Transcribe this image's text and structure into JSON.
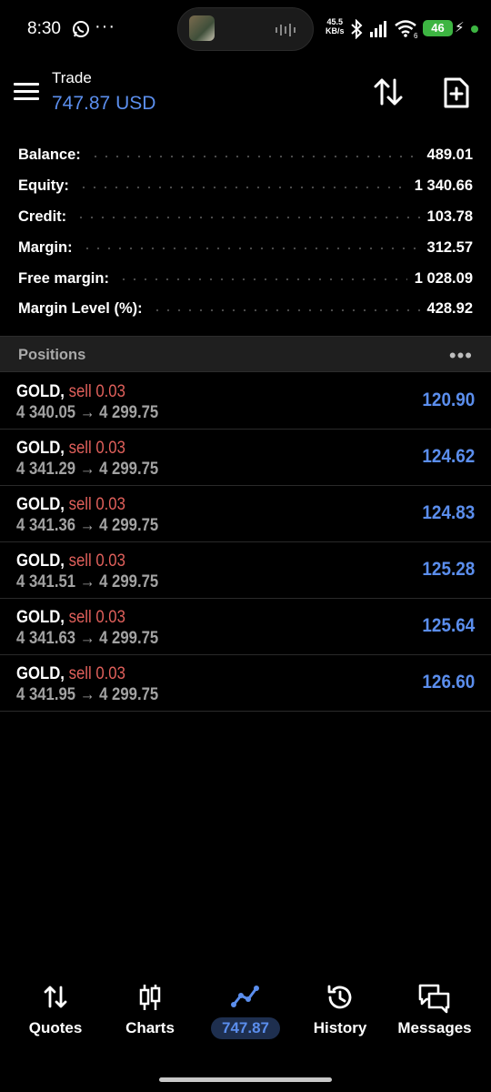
{
  "status_bar": {
    "time": "8:30",
    "more": "···",
    "net_speed_value": "45.5",
    "net_speed_unit": "KB/s",
    "battery": "46",
    "wifi_label": "6"
  },
  "header": {
    "title": "Trade",
    "subtitle": "747.87 USD"
  },
  "summary": [
    {
      "label": "Balance:",
      "value": "489.01"
    },
    {
      "label": "Equity:",
      "value": "1 340.66"
    },
    {
      "label": "Credit:",
      "value": "103.78"
    },
    {
      "label": "Margin:",
      "value": "312.57"
    },
    {
      "label": "Free margin:",
      "value": "1 028.09"
    },
    {
      "label": "Margin Level (%):",
      "value": "428.92"
    }
  ],
  "positions": {
    "title": "Positions",
    "more": "•••",
    "items": [
      {
        "symbol": "GOLD,",
        "side": "sell 0.03",
        "open": "4 340.05",
        "arrow": "→",
        "current": "4 299.75",
        "profit": "120.90"
      },
      {
        "symbol": "GOLD,",
        "side": "sell 0.03",
        "open": "4 341.29",
        "arrow": "→",
        "current": "4 299.75",
        "profit": "124.62"
      },
      {
        "symbol": "GOLD,",
        "side": "sell 0.03",
        "open": "4 341.36",
        "arrow": "→",
        "current": "4 299.75",
        "profit": "124.83"
      },
      {
        "symbol": "GOLD,",
        "side": "sell 0.03",
        "open": "4 341.51",
        "arrow": "→",
        "current": "4 299.75",
        "profit": "125.28"
      },
      {
        "symbol": "GOLD,",
        "side": "sell 0.03",
        "open": "4 341.63",
        "arrow": "→",
        "current": "4 299.75",
        "profit": "125.64"
      },
      {
        "symbol": "GOLD,",
        "side": "sell 0.03",
        "open": "4 341.95",
        "arrow": "→",
        "current": "4 299.75",
        "profit": "126.60"
      }
    ]
  },
  "bottom_nav": [
    {
      "label": "Quotes",
      "icon": "quotes-arrows-icon"
    },
    {
      "label": "Charts",
      "icon": "candlestick-icon"
    },
    {
      "label": "747.87",
      "icon": "trade-line-icon",
      "active": true
    },
    {
      "label": "History",
      "icon": "history-clock-icon"
    },
    {
      "label": "Messages",
      "icon": "messages-bubbles-icon"
    }
  ],
  "colors": {
    "accent": "#5b8eed",
    "sell": "#e0605b",
    "background": "#000000",
    "section_header": "#1f1f1f",
    "battery_green": "#3db542"
  }
}
